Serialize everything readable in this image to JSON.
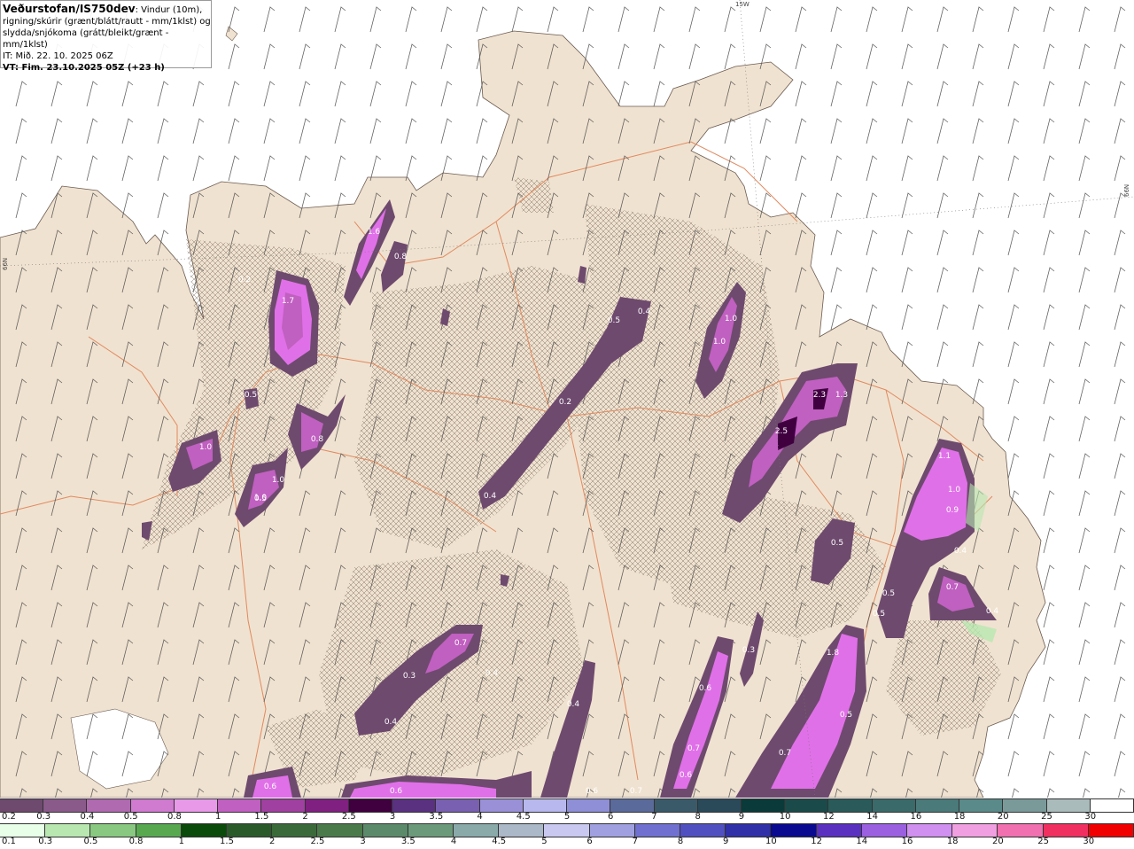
{
  "header": {
    "title": "Veðurstofan/IS750dev",
    "desc_part1": ": Vindur (10m),",
    "desc_line2": "rigning/skúrir (grænt/blátt/rautt - mm/1klst) og",
    "desc_line3": "slydda/snjókoma (grátt/bleikt/grænt - mm/1klst)",
    "it_line": "IT: Mið. 22. 10. 2025 06Z",
    "vt_line": "VT: Fim. 23.10.2025 05Z (+23 h)"
  },
  "map_edge_labels": {
    "top": "15W",
    "right": "66N",
    "left": "66N"
  },
  "precip_labels": [
    "1.6",
    "0.8",
    "1.7",
    "0.5",
    "0.8",
    "1.0",
    "1.0",
    "0.5",
    "0.4",
    "0.4",
    "0.2",
    "1.0",
    "1.0",
    "2.3",
    "1.3",
    "2.5",
    "0.5",
    "1.1",
    "1.0",
    "0.9",
    "0.4",
    "0.7",
    "0.5",
    "0.5",
    "0.4",
    "1.8",
    "0.5",
    "0.7",
    "0.6",
    "0.7",
    "0.6",
    "0.7",
    "0.3",
    "0.4",
    "0.4",
    "0.6",
    "0.7",
    "0.3",
    "0.4",
    "1.0",
    "0.5",
    "0.6",
    "0.6",
    "0.2"
  ],
  "legend_snow": {
    "ticks": [
      "0.2",
      "0.3",
      "0.4",
      "0.5",
      "0.8",
      "1",
      "1.5",
      "2",
      "2.5",
      "3",
      "3.5",
      "4",
      "4.5",
      "5",
      "6",
      "7",
      "8",
      "9",
      "10",
      "12",
      "14",
      "16",
      "18",
      "20",
      "25",
      "30"
    ],
    "colors": [
      "#6e4a6e",
      "#8a5a8a",
      "#b06ab0",
      "#d07ad0",
      "#e89ae8",
      "#c060c0",
      "#a040a0",
      "#802080",
      "#400040",
      "#5a3080",
      "#7a60b0",
      "#9a90d8",
      "#b8b8ee",
      "#8f8fd8",
      "#5a6a9a",
      "#3a5a6a",
      "#2a4a5a",
      "#0a3a3a",
      "#1a4a4a",
      "#2a5a5a",
      "#3a6a6a",
      "#4a7a7a",
      "#5a8a8a",
      "#7a9a9a",
      "#aabbbb",
      "#ffffff"
    ]
  },
  "legend_rain": {
    "ticks": [
      "0.1",
      "0.3",
      "0.5",
      "0.8",
      "1",
      "1.5",
      "2",
      "2.5",
      "3",
      "3.5",
      "4",
      "4.5",
      "5",
      "6",
      "7",
      "8",
      "9",
      "10",
      "12",
      "14",
      "16",
      "18",
      "20",
      "25",
      "30"
    ],
    "colors": [
      "#e8ffe8",
      "#b8e8b0",
      "#88c880",
      "#58a850",
      "#0a4a0a",
      "#2a5a2a",
      "#3a6a3a",
      "#4a7a4a",
      "#5a8a6a",
      "#6a9a7a",
      "#8aaaaa",
      "#aab8c8",
      "#c8c8f0",
      "#a0a0e0",
      "#7070d0",
      "#5050c0",
      "#3030a8",
      "#0a0a90",
      "#5a30c0",
      "#9a60e0",
      "#d090f0",
      "#f0a0e0",
      "#f070b0",
      "#f03060",
      "#f00000"
    ]
  },
  "colors": {
    "land": "#f0e2d0",
    "sea": "#ffffff",
    "precip_light": "#6e4a6e",
    "precip_mid": "#c060c0",
    "precip_heavy": "#e070e8",
    "roads": "#e08a60"
  }
}
